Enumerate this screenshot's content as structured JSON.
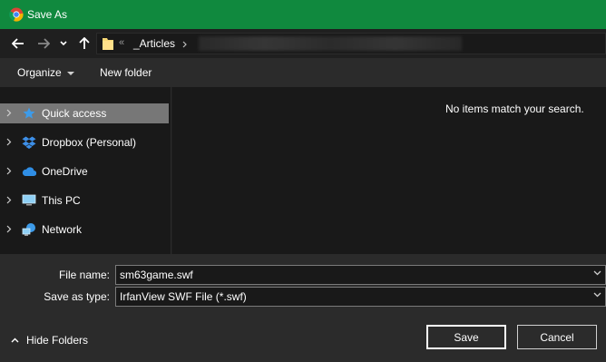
{
  "window": {
    "title": "Save As",
    "app_icon": "chrome-icon"
  },
  "nav": {
    "back_icon": "arrow-left-icon",
    "forward_icon": "arrow-right-icon",
    "recent_icon": "chevron-down-icon",
    "up_icon": "arrow-up-icon"
  },
  "address": {
    "overflow": "«",
    "crumb": "_Articles"
  },
  "toolbar": {
    "organize_label": "Organize",
    "new_folder_label": "New folder"
  },
  "sidebar": {
    "items": [
      {
        "label": "Quick access",
        "icon": "star-icon",
        "selected": true
      },
      {
        "label": "Dropbox (Personal)",
        "icon": "dropbox-icon"
      },
      {
        "label": "OneDrive",
        "icon": "cloud-icon"
      },
      {
        "label": "This PC",
        "icon": "monitor-icon"
      },
      {
        "label": "Network",
        "icon": "network-icon"
      }
    ]
  },
  "main": {
    "empty_message": "No items match your search."
  },
  "form": {
    "filename_label": "File name:",
    "filename_value": "sm63game.swf",
    "savetype_label": "Save as type:",
    "savetype_value": "IrfanView SWF File (*.swf)"
  },
  "footer": {
    "hide_folders_label": "Hide Folders",
    "save_label": "Save",
    "cancel_label": "Cancel"
  },
  "colors": {
    "titlebar": "#10893e",
    "selected": "#777777",
    "panel": "#191919",
    "chrome": "#2b2b2b"
  }
}
